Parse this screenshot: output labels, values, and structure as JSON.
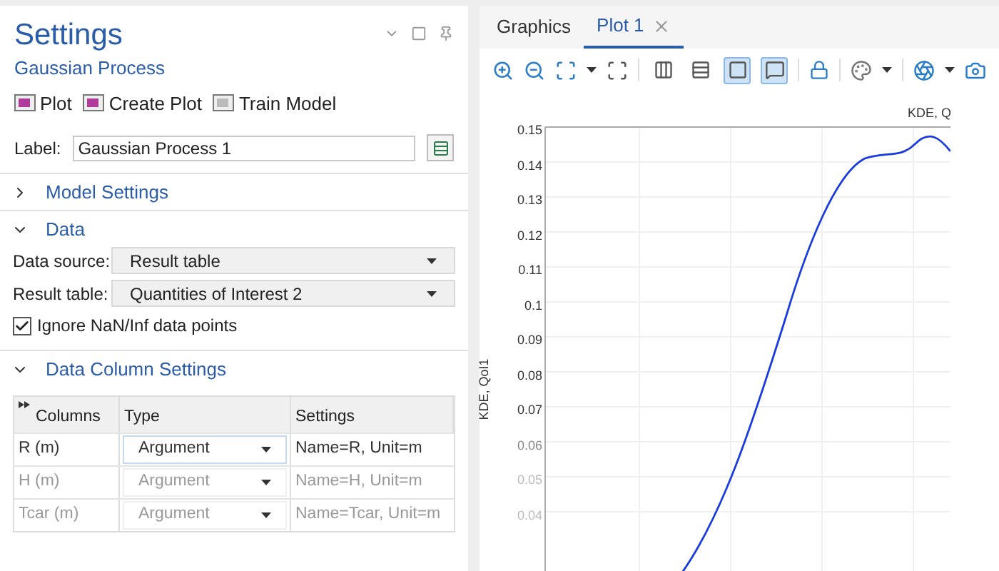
{
  "settings": {
    "title": "Settings",
    "subtitle": "Gaussian Process",
    "actions": [
      {
        "label": "Plot"
      },
      {
        "label": "Create Plot"
      },
      {
        "label": "Train Model"
      }
    ],
    "label_field": {
      "label": "Label:",
      "value": "Gaussian Process 1"
    },
    "sections": [
      {
        "title": "Model Settings",
        "expanded": false
      },
      {
        "title": "Data",
        "expanded": true
      },
      {
        "title": "Data Column Settings",
        "expanded": true
      }
    ],
    "data_source": {
      "label": "Data source:",
      "value": "Result table"
    },
    "result_table": {
      "label": "Result table:",
      "value": "Quantities of Interest 2"
    },
    "ignore_nan": {
      "label": "Ignore NaN/Inf data points",
      "checked": true
    },
    "table": {
      "columns": [
        "Columns",
        "Type",
        "Settings"
      ],
      "rows": [
        {
          "name": "R (m)",
          "type": "Argument",
          "settings": "Name=R, Unit=m",
          "selected": true
        },
        {
          "name": "H (m)",
          "type": "Argument",
          "settings": "Name=H, Unit=m",
          "selected": false
        },
        {
          "name": "Tcar (m)",
          "type": "Argument",
          "settings": "Name=Tcar, Unit=m",
          "selected": false
        }
      ]
    }
  },
  "graphics": {
    "tabs": [
      {
        "label": "Graphics",
        "selected": false
      },
      {
        "label": "Plot 1",
        "selected": true,
        "closable": true
      }
    ],
    "toolbar_toggles": [
      {
        "selected": false
      },
      {
        "selected": false
      },
      {
        "selected": true
      },
      {
        "selected": true
      }
    ],
    "plot": {
      "title": "KDE, Q",
      "ylabel": "KDE, QoI1",
      "yticks": [
        "0.15",
        "0.14",
        "0.13",
        "0.12",
        "0.11",
        "0.1",
        "0.09",
        "0.08",
        "0.07",
        "0.06",
        "0.05",
        "0.04"
      ]
    }
  }
}
